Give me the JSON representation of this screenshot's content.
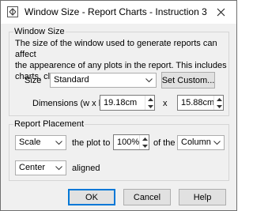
{
  "window": {
    "title": "Window Size - Report Charts - Instruction 3"
  },
  "window_size": {
    "legend": "Window Size",
    "description_lines": [
      "The size of the window used to generate reports can affect",
      "the appearence of any plots in the report. This includes",
      "charts, clouds and image maps."
    ],
    "size_label": "Size",
    "size_value": "Standard",
    "set_custom_label": "Set Custom...",
    "dimensions_label": "Dimensions (w x h)",
    "width_value": "19.18cm",
    "x_label": "x",
    "height_value": "15.88cm"
  },
  "report_placement": {
    "legend": "Report Placement",
    "mode_value": "Scale",
    "the_plot_to_label": "the plot to",
    "percent_value": "100%",
    "of_the_label": "of the",
    "target_value": "Column",
    "align_value": "Center",
    "aligned_label": "aligned"
  },
  "buttons": {
    "ok": "OK",
    "cancel": "Cancel",
    "help": "Help"
  },
  "icons": [
    "app-icon",
    "close-icon",
    "chevron-down-icon",
    "spin-up-icon",
    "spin-down-icon"
  ]
}
